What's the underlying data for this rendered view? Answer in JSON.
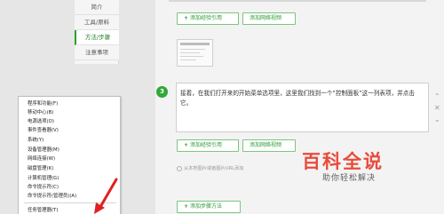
{
  "tabs": [
    {
      "label": "简介",
      "active": false
    },
    {
      "label": "工具/原料",
      "active": false
    },
    {
      "label": "方法/步骤",
      "active": true
    },
    {
      "label": "注意事项",
      "active": false
    }
  ],
  "context_menu": {
    "items": [
      "程序和功能(F)",
      "移动中心(B)",
      "电源选项(O)",
      "事件查看器(V)",
      "系统(Y)",
      "设备管理器(M)",
      "网络连接(W)",
      "磁盘管理(K)",
      "计算机管理(G)",
      "命令提示符(C)",
      "命令提示符(管理员)(A)",
      "任务管理器(T)"
    ]
  },
  "buttons": {
    "add_quote": "添加经验引用",
    "add_video": "添加网络视频",
    "add_step": "添加步骤方法"
  },
  "step": {
    "number": "3",
    "text": "接着，在我们打开来的开始菜单选项里，这里我们找到一个“控制面板”这一列表项，并点击它。"
  },
  "image_caption": "从本地图片或者图片URL添加",
  "watermark": {
    "title": "百科全说",
    "subtitle": "助你轻松解决"
  },
  "colors": {
    "accent_green": "#2fa936",
    "button_text_green": "#2d9a34",
    "watermark_red": "#e94b3a",
    "arrow_red": "#e02020"
  },
  "icons": {
    "step_controls": [
      "chevron-up-icon",
      "close-icon",
      "chevron-down-icon"
    ],
    "caption": "image-icon",
    "arrow": "red-arrow-icon"
  }
}
